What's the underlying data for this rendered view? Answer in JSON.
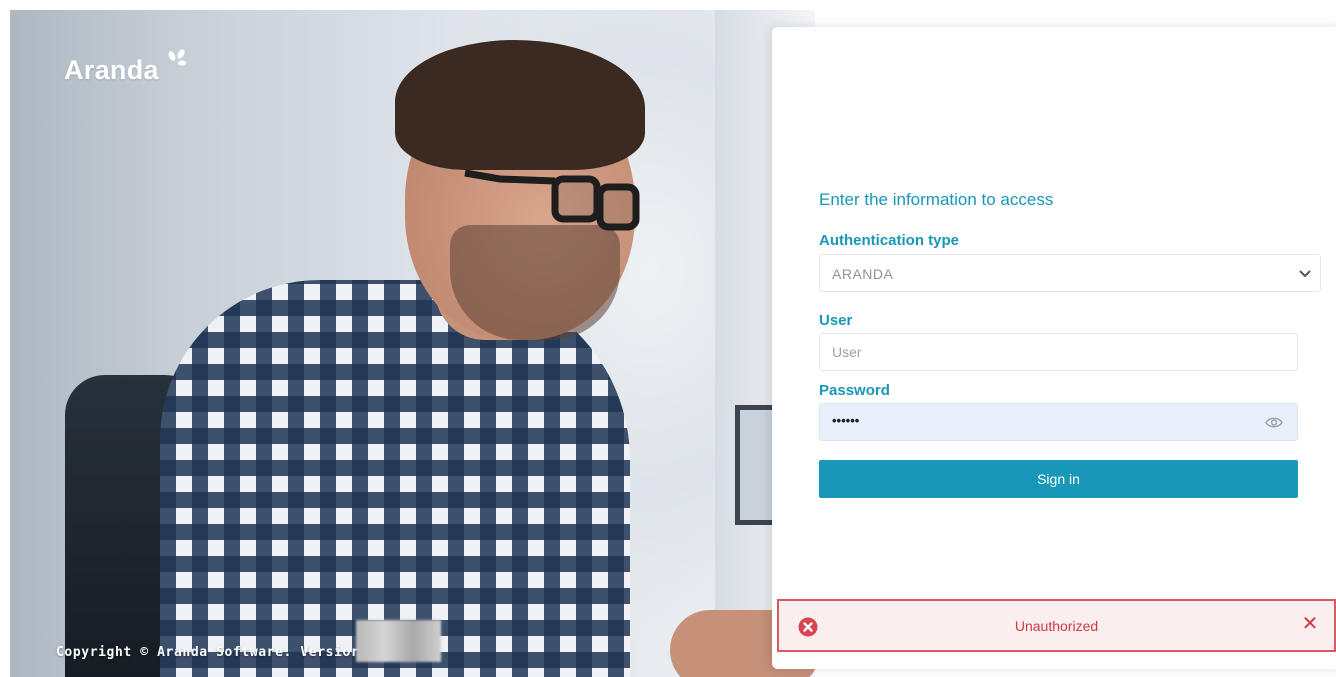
{
  "brand": {
    "logo_text": "Aranda",
    "copyright": "Copyright © Aranda Software. Versior"
  },
  "login": {
    "heading": "Enter the information to access",
    "auth_label": "Authentication type",
    "auth_value": "ARANDA",
    "user_label": "User",
    "user_placeholder": "User",
    "password_label": "Password",
    "password_masked": "••••••",
    "signin_label": "Sign in"
  },
  "alert": {
    "message": "Unauthorized",
    "close_symbol": "✕",
    "icon": "error-circle-icon"
  },
  "colors": {
    "accent": "#1897b8",
    "error": "#cc3b45",
    "error_bg": "#fbeeee",
    "password_bg": "#e8f0fb"
  }
}
